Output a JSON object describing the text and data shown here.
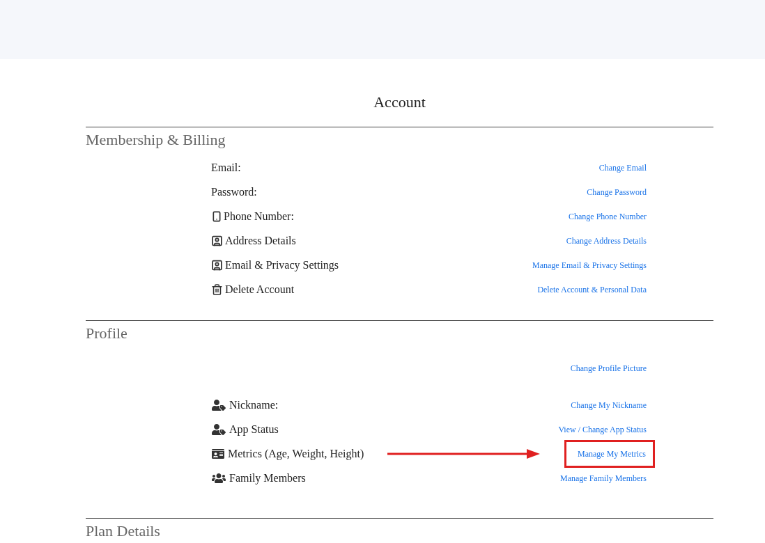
{
  "title": "Account",
  "sections": [
    {
      "heading": "Membership & Billing",
      "rows": [
        {
          "kind": "plain",
          "label": "Email:",
          "link": "Change Email",
          "highlighted": false
        },
        {
          "kind": "plain",
          "label": "Password:",
          "link": "Change Password",
          "highlighted": false
        },
        {
          "kind": "phone",
          "label": "Phone Number:",
          "link": "Change Phone Number",
          "highlighted": false
        },
        {
          "kind": "contact",
          "label": "Address Details",
          "link": "Change Address Details",
          "highlighted": false
        },
        {
          "kind": "contact",
          "label": "Email & Privacy Settings",
          "link": "Manage Email & Privacy Settings",
          "highlighted": false
        },
        {
          "kind": "trash",
          "label": "Delete Account",
          "link": "Delete Account & Personal Data",
          "highlighted": false
        }
      ]
    },
    {
      "heading": "Profile",
      "rows": [
        {
          "kind": "picture",
          "link": "Change Profile Picture",
          "highlighted": false
        },
        {
          "kind": "user-tag",
          "label": "Nickname:",
          "link": "Change My Nickname",
          "highlighted": false
        },
        {
          "kind": "user-tag",
          "label": "App Status",
          "link": "View / Change App Status",
          "highlighted": false
        },
        {
          "kind": "id-card",
          "label": "Metrics (Age, Weight, Height)",
          "link": "Manage My Metrics",
          "highlighted": true
        },
        {
          "kind": "users",
          "label": "Family Members",
          "link": "Manage Family Members",
          "highlighted": false
        }
      ]
    },
    {
      "heading": "Plan Details"
    }
  ]
}
